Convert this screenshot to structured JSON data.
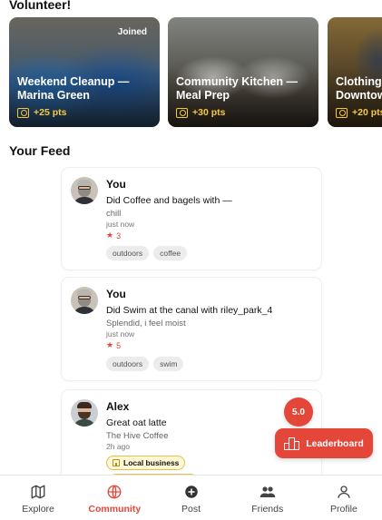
{
  "sections": {
    "volunteer_title": "Volunteer!",
    "feed_title": "Your Feed"
  },
  "volunteer_cards": [
    {
      "title": "Weekend Cleanup — Marina Green",
      "points": "+25 pts",
      "badge": "Joined"
    },
    {
      "title": "Community Kitchen — Meal Prep",
      "points": "+30 pts"
    },
    {
      "title": "Clothing Downtow",
      "points": "+20 pts"
    }
  ],
  "feed": [
    {
      "author": "You",
      "text": "Did Coffee and bagels with —",
      "sub": "chill",
      "time": "just now",
      "rating": "3",
      "tags": [
        "outdoors",
        "coffee"
      ]
    },
    {
      "author": "You",
      "text": "Did Swim at the canal with riley_park_4",
      "sub": "Splendid, i feel moist",
      "time": "just now",
      "rating": "5",
      "tags": [
        "outdoors",
        "swim"
      ]
    },
    {
      "author": "Alex",
      "text": "Great oat latte",
      "sub": "The Hive Coffee",
      "time": "2h ago",
      "badge": "Local business"
    }
  ],
  "floating": {
    "score": "5.0",
    "leaderboard_label": "Leaderboard"
  },
  "tabs": [
    {
      "label": "Explore",
      "icon": "map-icon",
      "active": false
    },
    {
      "label": "Community",
      "icon": "globe-icon",
      "active": true
    },
    {
      "label": "Post",
      "icon": "plus-circle-icon",
      "active": false
    },
    {
      "label": "Friends",
      "icon": "people-icon",
      "active": false
    },
    {
      "label": "Profile",
      "icon": "person-icon",
      "active": false
    }
  ],
  "colors": {
    "accent": "#e5463a",
    "points": "#f5c842",
    "badge_bg": "#fff7d6"
  }
}
